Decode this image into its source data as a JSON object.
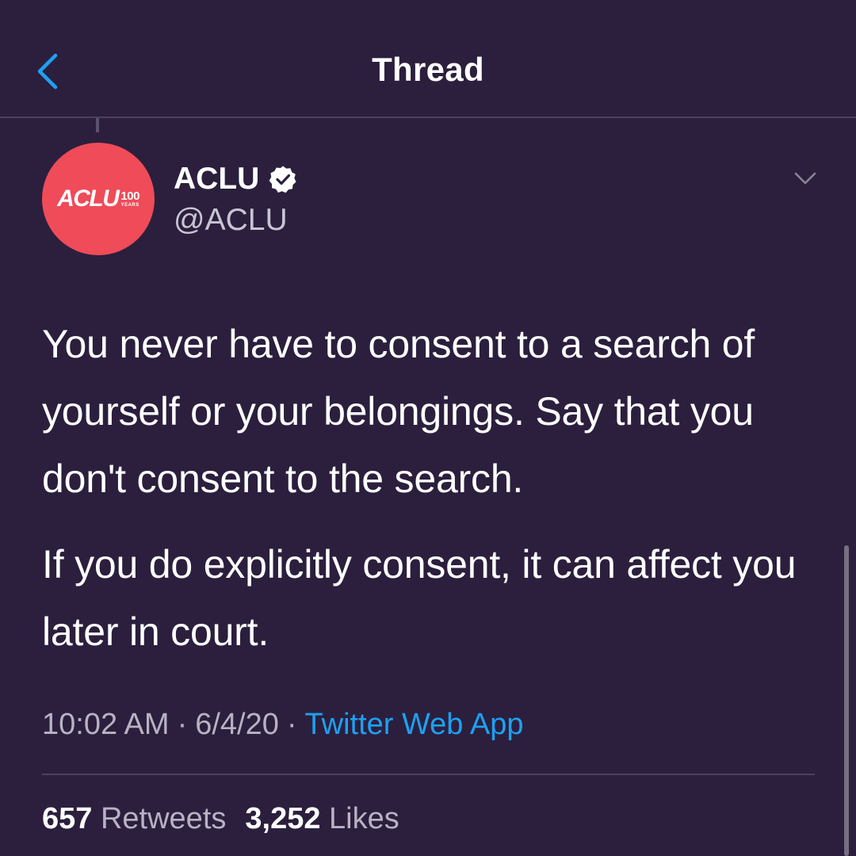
{
  "header": {
    "title": "Thread",
    "back_icon": "chevron-left-icon",
    "accent_color": "#1da1f2"
  },
  "tweet": {
    "author": {
      "name": "ACLU",
      "handle": "@ACLU",
      "verified": true,
      "avatar": {
        "logo_text": "ACLU",
        "logo_number": "100",
        "logo_sub": "YEARS",
        "color": "#ef4b59"
      }
    },
    "text": [
      "You never have to consent to a search of yourself or your belongings. Say that you don't consent to the search.",
      "If you do explicitly consent, it can affect you later in court."
    ],
    "time": "10:02 AM",
    "date": "6/4/20",
    "separator": "·",
    "source": "Twitter Web App",
    "stats": {
      "retweets_count": "657",
      "retweets_label": "Retweets",
      "likes_count": "3,252",
      "likes_label": "Likes"
    }
  },
  "colors": {
    "background": "#2b1f3d",
    "text_primary": "#ffffff",
    "text_secondary": "#b8b2c4",
    "link": "#1da1f2",
    "divider": "#4b4060"
  }
}
